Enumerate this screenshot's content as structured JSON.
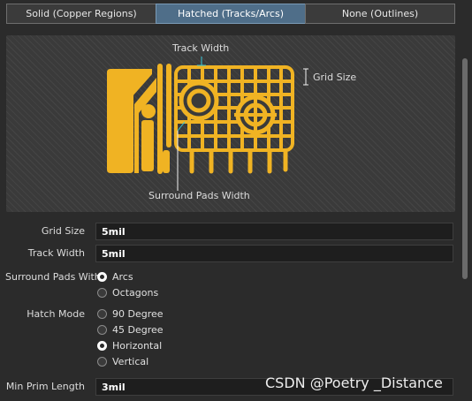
{
  "tabs": [
    {
      "label": "Solid (Copper Regions)"
    },
    {
      "label": "Hatched (Tracks/Arcs)"
    },
    {
      "label": "None (Outlines)"
    }
  ],
  "preview": {
    "track_width_caption": "Track Width",
    "grid_size_caption": "Grid Size",
    "surround_caption": "Surround Pads Width"
  },
  "grid_size": {
    "label": "Grid Size",
    "value": "5mil"
  },
  "track_width": {
    "label": "Track Width",
    "value": "5mil"
  },
  "surround_pads": {
    "label": "Surround Pads With",
    "options": [
      {
        "label": "Arcs",
        "selected": true
      },
      {
        "label": "Octagons",
        "selected": false
      }
    ]
  },
  "hatch_mode": {
    "label": "Hatch Mode",
    "options": [
      {
        "label": "90 Degree",
        "selected": false
      },
      {
        "label": "45 Degree",
        "selected": false
      },
      {
        "label": "Horizontal",
        "selected": true
      },
      {
        "label": "Vertical",
        "selected": false
      }
    ]
  },
  "min_prim_length": {
    "label": "Min Prim Length",
    "value": "3mil"
  },
  "watermark": "CSDN @Poetry _Distance",
  "colors": {
    "copper": "#f0b323",
    "accent": "#4f6e89"
  }
}
